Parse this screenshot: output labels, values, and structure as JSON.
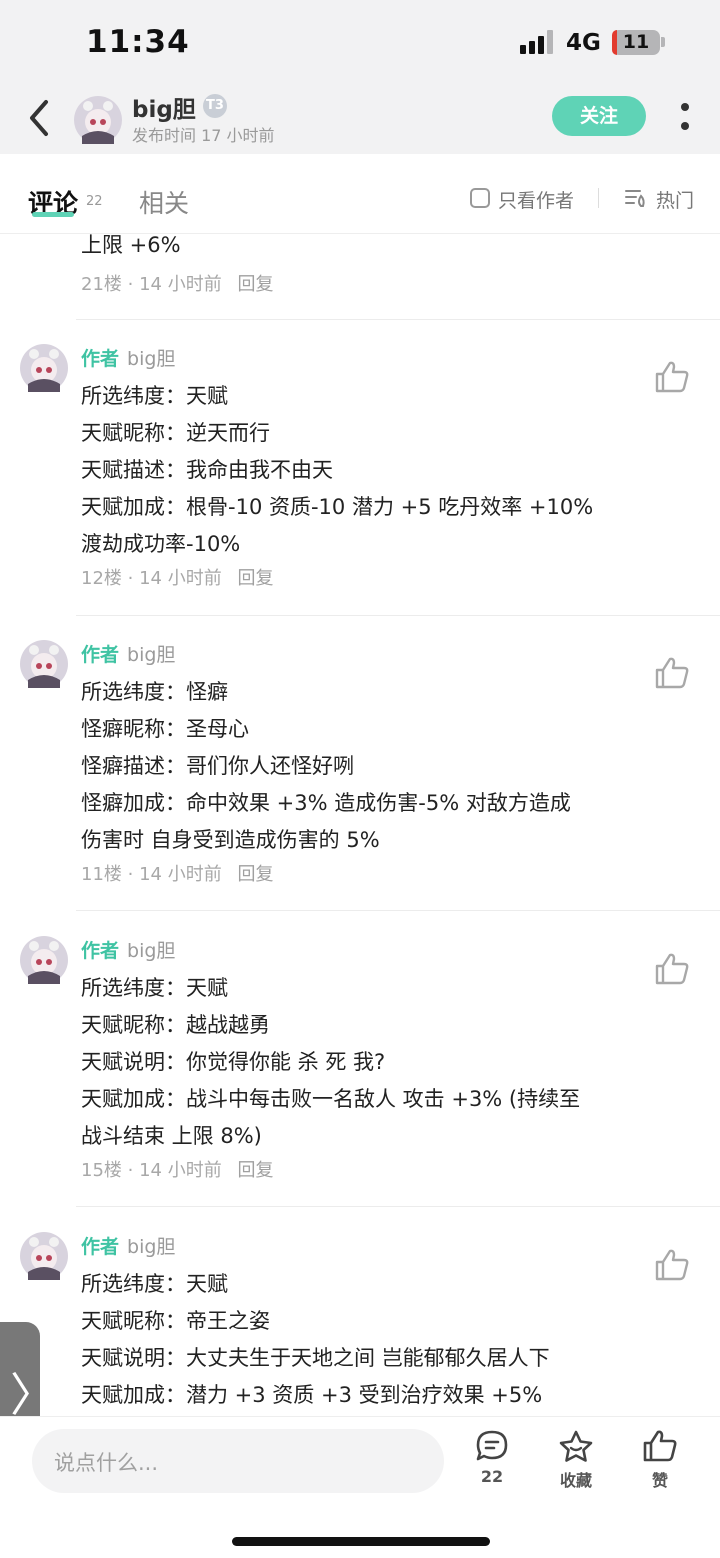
{
  "status_bar": {
    "time": "11:34",
    "network": "4G",
    "battery": "11"
  },
  "header": {
    "author_name": "big胆",
    "badge": "T3",
    "post_time": "发布时间 17 小时前",
    "follow_label": "关注"
  },
  "tabs": {
    "comments_label": "评论",
    "comments_count": "22",
    "related_label": "相关",
    "author_only_label": "只看作者",
    "sort_label": "热门"
  },
  "partial_comment": {
    "last_line": "上限 +6%",
    "floor": "21楼",
    "time": "14 小时前",
    "reply_label": "回复"
  },
  "comments": [
    {
      "author_tag": "作者",
      "name": "big胆",
      "lines": [
        "所选纬度：天赋",
        "天赋昵称：逆天而行",
        "天赋描述：我命由我不由天",
        "天赋加成：根骨-10 资质-10 潜力 +5 吃丹效率 +10%",
        "渡劫成功率-10%"
      ],
      "floor": "12楼",
      "time": "14 小时前",
      "reply_label": "回复"
    },
    {
      "author_tag": "作者",
      "name": "big胆",
      "lines": [
        "所选纬度：怪癖",
        "怪癖昵称：圣母心",
        "怪癖描述：哥们你人还怪好咧",
        "怪癖加成：命中效果 +3% 造成伤害-5%  对敌方造成",
        "伤害时 自身受到造成伤害的 5%"
      ],
      "floor": "11楼",
      "time": "14 小时前",
      "reply_label": "回复"
    },
    {
      "author_tag": "作者",
      "name": "big胆",
      "lines": [
        "所选纬度：天赋",
        "天赋昵称：越战越勇",
        "天赋说明：你觉得你能 杀 死 我?",
        "天赋加成：战斗中每击败一名敌人 攻击 +3% (持续至",
        "战斗结束 上限 8%)"
      ],
      "floor": "15楼",
      "time": "14 小时前",
      "reply_label": "回复"
    },
    {
      "author_tag": "作者",
      "name": "big胆",
      "lines": [
        "所选纬度：天赋",
        "天赋昵称：帝王之姿",
        "天赋说明：大丈夫生于天地之间 岂能郁郁久居人下",
        "天赋加成：潜力 +3 资质 +3 受到治疗效果 +5%"
      ],
      "floor": "",
      "time": "",
      "reply_label": ""
    }
  ],
  "bottom_bar": {
    "input_placeholder": "说点什么...",
    "comment_count": "22",
    "favorite_label": "收藏",
    "like_label": "赞"
  },
  "side_tab": {
    "glyph": "〉"
  },
  "colors": {
    "accent": "#5fd3b6",
    "author_tag": "#3fc3a3",
    "header_bg": "#f2f2f3"
  }
}
